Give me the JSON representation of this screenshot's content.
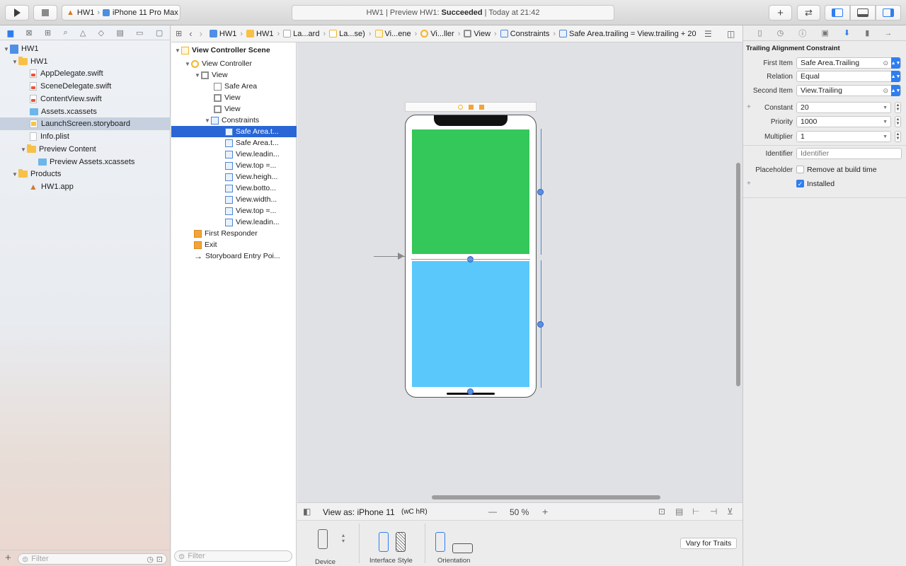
{
  "toolbar": {
    "scheme_project": "HW1",
    "scheme_device": "iPhone 11 Pro Max",
    "status_prefix": "HW1 | Preview HW1:",
    "status_result": "Succeeded",
    "status_time": "| Today at 21:42"
  },
  "navigator": {
    "items": [
      {
        "label": "HW1",
        "icon": "project-icon"
      },
      {
        "label": "HW1",
        "icon": "folder-icon"
      },
      {
        "label": "AppDelegate.swift",
        "icon": "swift-file-icon"
      },
      {
        "label": "SceneDelegate.swift",
        "icon": "swift-file-icon"
      },
      {
        "label": "ContentView.swift",
        "icon": "swift-file-icon"
      },
      {
        "label": "Assets.xcassets",
        "icon": "assets-icon"
      },
      {
        "label": "LaunchScreen.storyboard",
        "icon": "storyboard-icon"
      },
      {
        "label": "Info.plist",
        "icon": "plist-icon"
      },
      {
        "label": "Preview Content",
        "icon": "folder-icon"
      },
      {
        "label": "Preview Assets.xcassets",
        "icon": "assets-icon"
      },
      {
        "label": "Products",
        "icon": "folder-icon"
      },
      {
        "label": "HW1.app",
        "icon": "app-icon"
      }
    ],
    "filter_placeholder": "Filter"
  },
  "jumpbar": {
    "crumbs": [
      "HW1",
      "HW1",
      "La...ard",
      "La...se)",
      "Vi...ene",
      "Vi...ller",
      "View",
      "Constraints",
      "Safe Area.trailing = View.trailing + 20"
    ]
  },
  "outline": {
    "items": [
      {
        "label": "View Controller Scene"
      },
      {
        "label": "View Controller"
      },
      {
        "label": "View"
      },
      {
        "label": "Safe Area"
      },
      {
        "label": "View"
      },
      {
        "label": "View"
      },
      {
        "label": "Constraints"
      },
      {
        "label": "Safe Area.t..."
      },
      {
        "label": "Safe Area.t..."
      },
      {
        "label": "View.leadin..."
      },
      {
        "label": "View.top =..."
      },
      {
        "label": "View.heigh..."
      },
      {
        "label": "View.botto..."
      },
      {
        "label": "View.width..."
      },
      {
        "label": "View.top =..."
      },
      {
        "label": "View.leadin..."
      },
      {
        "label": "First Responder"
      },
      {
        "label": "Exit"
      },
      {
        "label": "Storyboard Entry Poi..."
      }
    ],
    "filter_placeholder": "Filter"
  },
  "canvas": {
    "top_view_color": "#34c759",
    "bottom_view_color": "#5ac8fa"
  },
  "devicebar": {
    "view_as": "View as: iPhone 11",
    "size_class": "(wC hR)",
    "zoom_minus": "—",
    "zoom": "50 %",
    "zoom_plus": "+"
  },
  "traits": {
    "device": "Device",
    "interface_style": "Interface Style",
    "orientation": "Orientation",
    "vary_button": "Vary for Traits"
  },
  "inspector": {
    "title": "Trailing Alignment Constraint",
    "first_item_label": "First Item",
    "first_item": "Safe Area.Trailing",
    "relation_label": "Relation",
    "relation": "Equal",
    "second_item_label": "Second Item",
    "second_item": "View.Trailing",
    "constant_label": "Constant",
    "constant": "20",
    "priority_label": "Priority",
    "priority": "1000",
    "multiplier_label": "Multiplier",
    "multiplier": "1",
    "identifier_label": "Identifier",
    "identifier_placeholder": "Identifier",
    "placeholder_label": "Placeholder",
    "remove_at_build": "Remove at build time",
    "installed": "Installed",
    "installed_checked": true,
    "remove_checked": false
  }
}
